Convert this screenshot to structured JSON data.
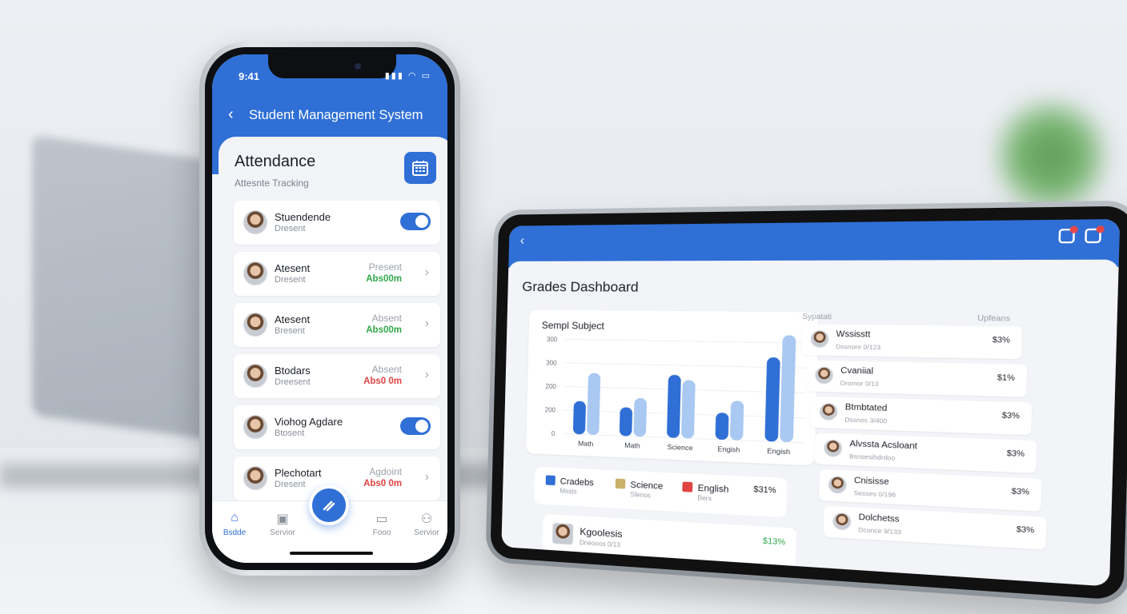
{
  "phone": {
    "status_time": "9:41",
    "header_title": "Student Management System",
    "attendance_title": "Attendance",
    "attendance_subtitle": "Attesnte Tracking",
    "rows": [
      {
        "name": "Stuendende",
        "status": "Dresent",
        "control": "toggle"
      },
      {
        "name": "Atesent",
        "status": "Dresent",
        "state_label": "Present",
        "state_value": "Abs00m",
        "state_color": "#2ea84a"
      },
      {
        "name": "Atesent",
        "status": "Bresent",
        "state_label": "Absent",
        "state_value": "Abs00m",
        "state_color": "#2ea84a"
      },
      {
        "name": "Btodars",
        "status": "Dreesent",
        "state_label": "Absent",
        "state_value": "Abs0 0m",
        "state_color": "#e04343"
      },
      {
        "name": "Viohog Agdare",
        "status": "Btosent",
        "control": "toggle"
      },
      {
        "name": "Plechotart",
        "status": "Dresent",
        "state_label": "Agdoint",
        "state_value": "Abs0 0m",
        "state_color": "#e04343"
      }
    ],
    "tabs": [
      {
        "label": "Bsdde",
        "icon": "home-icon",
        "active": true
      },
      {
        "label": "Servior",
        "icon": "briefcase-icon"
      },
      {
        "label": "Fooo",
        "icon": "card-icon"
      },
      {
        "label": "Servior",
        "icon": "user-icon"
      }
    ]
  },
  "tablet": {
    "title": "Grades Dashboard",
    "list_header_left": "Sypatati",
    "list_header_right": "Upfeans",
    "legend": [
      {
        "label": "Cradebs",
        "sub": "Mssts",
        "color": "#2f6fd6"
      },
      {
        "label": "Science",
        "sub": "Sfenos",
        "color": "#c9b26a"
      },
      {
        "label": "English",
        "sub": "Bers",
        "color": "#e04343"
      }
    ],
    "legend_pct": "$31%",
    "bottom": {
      "name": "Kgoolesis",
      "sub": "Dneooos 0/13",
      "pct": "$13%"
    },
    "students": [
      {
        "name": "Wssisstt",
        "sub": "Dssnore 0/123",
        "pct": "$3%"
      },
      {
        "name": "Cvaniial",
        "sub": "Dromor 0/13",
        "pct": "$1%"
      },
      {
        "name": "Btmbtated",
        "sub": "Dssnos 3/400",
        "pct": "$3%"
      },
      {
        "name": "Alvssta Acsloant",
        "sub": "Bsnsesihdrdoo",
        "pct": "$3%"
      },
      {
        "name": "Cnisisse",
        "sub": "Sesses 0/196",
        "pct": "$3%"
      },
      {
        "name": "Dolchetss",
        "sub": "Dconce 9/133",
        "pct": "$3%"
      }
    ]
  },
  "chart_data": {
    "type": "bar",
    "title": "Sempl Subject",
    "categories": [
      "Math",
      "Math",
      "Science",
      "Engish",
      "Engish"
    ],
    "series": [
      {
        "values": [
          140,
          120,
          260,
          110,
          340
        ],
        "color": "#2f6fd6"
      },
      {
        "values": [
          260,
          160,
          240,
          160,
          430
        ],
        "color": "#a9c8f2"
      }
    ],
    "ylim": [
      0,
      400
    ],
    "yticks": [
      "0",
      "200",
      "200",
      "300",
      "300"
    ]
  }
}
